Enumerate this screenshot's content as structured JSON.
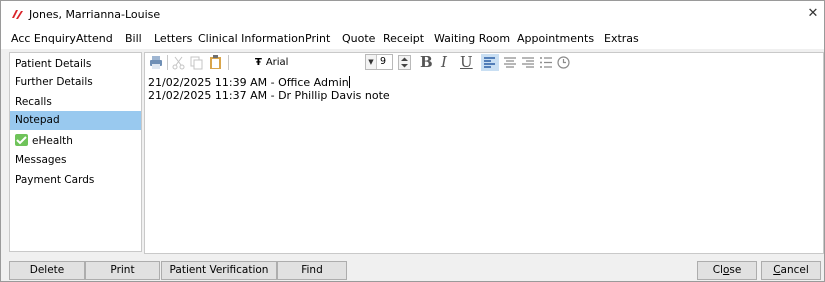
{
  "window": {
    "title": "Jones, Marrianna-Louise"
  },
  "menu": [
    "Acc Enquiry",
    "Attend",
    "Bill",
    "Letters",
    "Clinical Information",
    "Print",
    "Quote",
    "Receipt",
    "Waiting Room",
    "Appointments",
    "Extras"
  ],
  "sidebar": {
    "items": [
      {
        "label": "Patient Details",
        "active": false
      },
      {
        "label": "Further Details",
        "active": false
      },
      {
        "label": "Recalls",
        "active": false
      },
      {
        "label": "Notepad",
        "active": true
      },
      {
        "label": "eHealth",
        "active": false,
        "icon": "check-icon"
      },
      {
        "label": "Messages",
        "active": false
      },
      {
        "label": "Payment Cards",
        "active": false
      }
    ]
  },
  "toolbar": {
    "font": "Arial",
    "font_size": "9",
    "bold": "B",
    "italic": "I",
    "underline": "U",
    "font_prefix": "Ŧ"
  },
  "notes": [
    "21/02/2025 11:39 AM - Office Admin",
    "21/02/2025 11:37 AM - Dr Phillip Davis note"
  ],
  "buttons": {
    "delete": "Delete",
    "print": "Print",
    "patient_verification": "Patient Verification",
    "find": "Find",
    "close_pre": "Cl",
    "close_u": "o",
    "close_post": "se",
    "cancel_u": "C",
    "cancel_post": "ancel"
  },
  "colors": {
    "accent": "#99c9ef",
    "brand_red": "#d9242a",
    "check_green": "#6fc35a"
  }
}
